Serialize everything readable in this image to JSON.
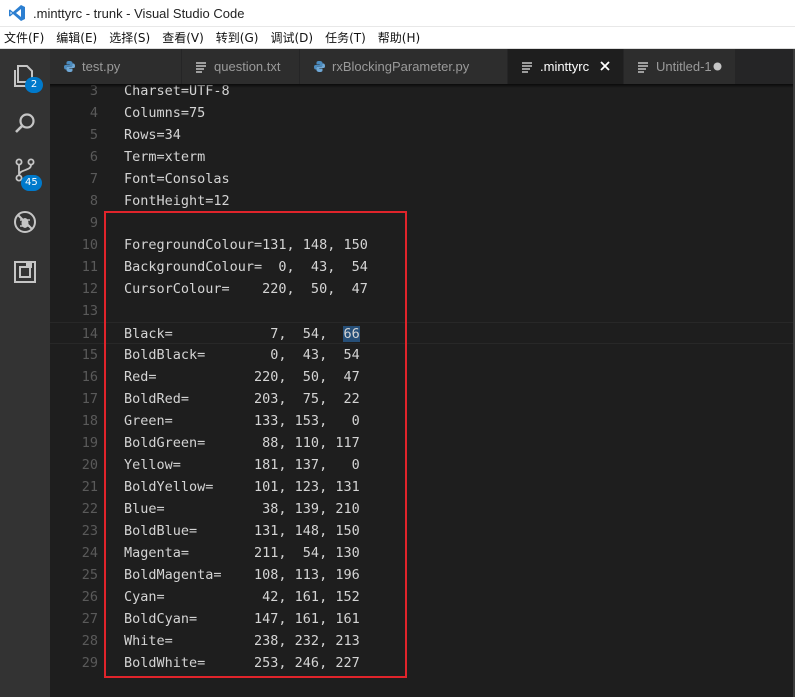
{
  "window": {
    "title": ".minttyrc - trunk - Visual Studio Code"
  },
  "menu": [
    "文件(F)",
    "编辑(E)",
    "选择(S)",
    "查看(V)",
    "转到(G)",
    "调试(D)",
    "任务(T)",
    "帮助(H)"
  ],
  "activity": {
    "explorer_badge": "2",
    "scm_badge": "45"
  },
  "tabs": [
    {
      "label": "test.py",
      "icon": "python-icon",
      "active": false
    },
    {
      "label": "question.txt",
      "icon": "file-lines-icon",
      "active": false
    },
    {
      "label": "rxBlockingParameter.py",
      "icon": "python-icon",
      "active": false
    },
    {
      "label": ".minttyrc",
      "icon": "file-lines-icon",
      "active": true,
      "close": "×"
    },
    {
      "label": "Untitled-1",
      "icon": "file-lines-icon",
      "active": false,
      "dirty": true
    }
  ],
  "editor": {
    "lines": [
      {
        "n": "3",
        "text": "Charset=UTF-8"
      },
      {
        "n": "4",
        "text": "Columns=75"
      },
      {
        "n": "5",
        "text": "Rows=34"
      },
      {
        "n": "6",
        "text": "Term=xterm"
      },
      {
        "n": "7",
        "text": "Font=Consolas"
      },
      {
        "n": "8",
        "text": "FontHeight=12"
      },
      {
        "n": "9",
        "text": ""
      },
      {
        "n": "10",
        "text": "ForegroundColour=131, 148, 150"
      },
      {
        "n": "11",
        "text": "BackgroundColour=  0,  43,  54"
      },
      {
        "n": "12",
        "text": "CursorColour=    220,  50,  47"
      },
      {
        "n": "13",
        "text": ""
      },
      {
        "n": "14",
        "text": "Black=            7,  54,  66"
      },
      {
        "n": "15",
        "text": "BoldBlack=        0,  43,  54"
      },
      {
        "n": "16",
        "text": "Red=            220,  50,  47"
      },
      {
        "n": "17",
        "text": "BoldRed=        203,  75,  22"
      },
      {
        "n": "18",
        "text": "Green=          133, 153,   0"
      },
      {
        "n": "19",
        "text": "BoldGreen=       88, 110, 117"
      },
      {
        "n": "20",
        "text": "Yellow=         181, 137,   0"
      },
      {
        "n": "21",
        "text": "BoldYellow=     101, 123, 131"
      },
      {
        "n": "22",
        "text": "Blue=            38, 139, 210"
      },
      {
        "n": "23",
        "text": "BoldBlue=       131, 148, 150"
      },
      {
        "n": "24",
        "text": "Magenta=        211,  54, 130"
      },
      {
        "n": "25",
        "text": "BoldMagenta=    108, 113, 196"
      },
      {
        "n": "26",
        "text": "Cyan=            42, 161, 152"
      },
      {
        "n": "27",
        "text": "BoldCyan=       147, 161, 161"
      },
      {
        "n": "28",
        "text": "White=          238, 232, 213"
      },
      {
        "n": "29",
        "text": "BoldWhite=      253, 246, 227"
      }
    ],
    "current_line": "14",
    "selected_word": "66"
  },
  "colors": {
    "accent": "#007acc",
    "highlight_box": "#e0242b",
    "editor_bg": "#1e1e1e",
    "activity_bg": "#333333"
  }
}
